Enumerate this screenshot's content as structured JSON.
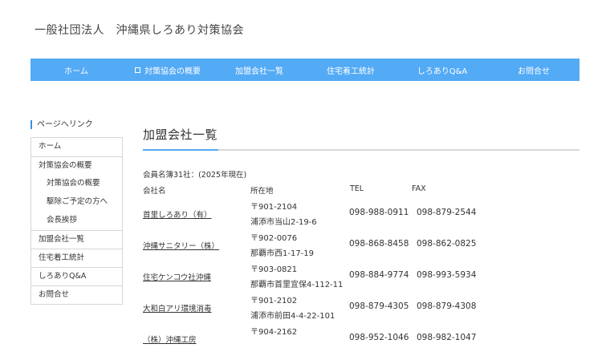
{
  "site": {
    "title": "一般社団法人　沖縄県しろあり対策協会"
  },
  "nav": {
    "items": [
      {
        "label": "ホーム"
      },
      {
        "label": "対策協会の概要"
      },
      {
        "label": "加盟会社一覧"
      },
      {
        "label": "住宅着工統計"
      },
      {
        "label": "しろありQ&A"
      },
      {
        "label": "お問合せ"
      }
    ]
  },
  "sidebar": {
    "heading": "ページへリンク",
    "items": [
      {
        "label": "ホーム"
      },
      {
        "label": "対策協会の概要"
      },
      {
        "label": "対策協会の概要"
      },
      {
        "label": "駆除ご予定の方へ"
      },
      {
        "label": "会長挨拶"
      },
      {
        "label": "加盟会社一覧"
      },
      {
        "label": "住宅着工統計"
      },
      {
        "label": "しろありQ&A"
      },
      {
        "label": "お問合せ"
      }
    ]
  },
  "main": {
    "heading": "加盟会社一覧",
    "note": "会員名簿31社：(2025年現在)",
    "columns": {
      "name": "会社名",
      "address": "所在地",
      "tel": "TEL",
      "fax": "FAX"
    },
    "rows": [
      {
        "name": "首里しろあり（有）",
        "zip": "〒901-2104",
        "address": "浦添市当山2-19-6",
        "tel": "098-988-0911",
        "fax": "098-879-2544"
      },
      {
        "name": "沖縄サニタリー（株）",
        "zip": "〒902-0076",
        "address": "那覇市西1-17-19",
        "tel": "098-868-8458",
        "fax": "098-862-0825"
      },
      {
        "name": "住宅ケンコウ社沖縄",
        "zip": "〒903-0821",
        "address": "那覇市首里宜保4-112-11",
        "tel": "098-884-9774",
        "fax": "098-993-5934"
      },
      {
        "name": "大和白アリ環境消毒",
        "zip": "〒901-2102",
        "address": "浦添市前田4-4-22-101",
        "tel": "098-879-4305",
        "fax": "098-879-4308"
      },
      {
        "name": "（株）沖縄工房",
        "zip": "〒904-2162",
        "address": "",
        "tel": "098-952-1046",
        "fax": "098-982-1047"
      }
    ]
  }
}
